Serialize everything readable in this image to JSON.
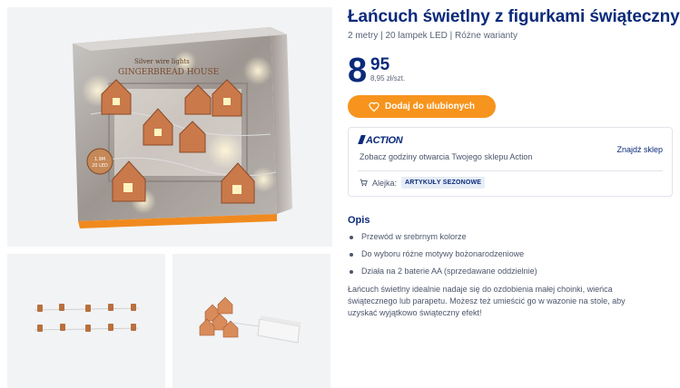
{
  "product": {
    "title": "Łańcuch świetlny z figurkami świątecznymi",
    "subtitle": "2 metry | 20 lampek LED | Różne warianty",
    "price_int": "8",
    "price_dec": "95",
    "price_unit": "8,95 zł/szt.",
    "favorite_label": "Dodaj do ulubionych"
  },
  "images": {
    "main_alt": "Gingerbread house light chain box",
    "thumbs": [
      "Light chain figures",
      "Light chain with battery box"
    ],
    "box_brand_text": "Silver wire lights",
    "box_label": "GINGERBREAD HOUSE",
    "box_badge": "1.9M 20 LED"
  },
  "store": {
    "logo_text": "ACTION",
    "description": "Zobacz godziny otwarcia Twojego sklepu Action",
    "find_store_label": "Znajdź sklep",
    "aisle_label": "Alejka:",
    "aisle_value": "ARTYKUŁY SEZONOWE"
  },
  "description": {
    "heading": "Opis",
    "bullets": [
      "Przewód w srebrnym kolorze",
      "Do wyboru różne motywy bożonarodzeniowe",
      "Działa na 2 baterie AA (sprzedawane oddzielnie)"
    ],
    "text": "Łańcuch świetlny idealnie nadaje się do ozdobienia małej choinki, wieńca świątecznego lub parapetu. Możesz też umieścić go w wazonie na stole, aby uzyskać wyjątkowo świąteczny efekt!"
  },
  "colors": {
    "brand_blue": "#0a2a7a",
    "accent_orange": "#f7941d"
  }
}
